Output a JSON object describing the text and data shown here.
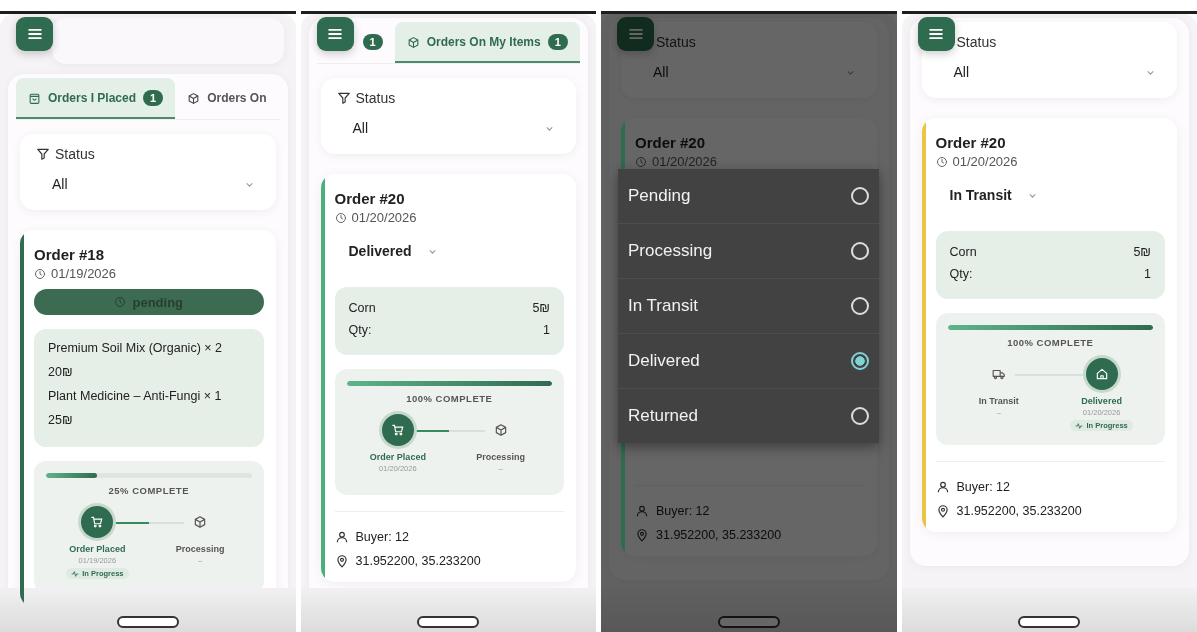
{
  "panels": [
    {
      "header": true,
      "dimmed": false,
      "tabs": [
        {
          "kind": "bag",
          "label": "Orders I Placed",
          "badge": "1",
          "selected": true
        },
        {
          "kind": "box",
          "label": "Orders On",
          "selected": false
        }
      ],
      "filter": {
        "label": "Status",
        "value": "All"
      },
      "order": {
        "title": "Order #18",
        "date": "01/19/2026",
        "color": "#2f6b4f",
        "status": {
          "kind": "pill",
          "label": "pending"
        },
        "items": {
          "kind": "stacked",
          "rows": [
            {
              "label": "Premium Soil Mix (Organic) × 2",
              "value": "20₪"
            },
            {
              "label": "Plant Medicine – Anti-Fungi × 1",
              "value": "25₪"
            }
          ]
        },
        "progress": {
          "level": 0.25,
          "label": "25% COMPLETE",
          "steps": [
            {
              "kind": "cart",
              "label": "Order Placed",
              "date": "01/19/2026",
              "active": true,
              "badge": "In Progress"
            },
            {
              "kind": "box",
              "label": "Processing",
              "date": "–",
              "active": false
            }
          ]
        }
      }
    },
    {
      "header": false,
      "dimmed": false,
      "tabs": [
        {
          "badge": "1",
          "selected": false
        },
        {
          "kind": "box",
          "label": "Orders On My Items",
          "badge": "1",
          "selected": true
        }
      ],
      "filter": {
        "label": "Status",
        "value": "All"
      },
      "order": {
        "title": "Order #20",
        "date": "01/20/2026",
        "color": "#4caf7d",
        "status": {
          "kind": "select",
          "label": "Delivered"
        },
        "items": {
          "kind": "split",
          "rows": [
            {
              "label": "Corn",
              "value": "5₪"
            },
            {
              "label": "Qty:",
              "value": "1"
            }
          ]
        },
        "progress": {
          "level": 1,
          "label": "100% COMPLETE",
          "steps": [
            {
              "kind": "cart",
              "label": "Order Placed",
              "date": "01/20/2026",
              "active": true
            },
            {
              "kind": "box",
              "label": "Processing",
              "date": "–",
              "active": false
            }
          ]
        },
        "buyer": "Buyer: 12",
        "location": "31.952200, 35.233200"
      }
    },
    {
      "header": false,
      "dimmed": true,
      "filter": {
        "label": "Status",
        "value": "All"
      },
      "order": {
        "title": "Order #20",
        "date": "01/20/2026",
        "color": "#2f6b4f",
        "covered": true,
        "buyer": "Buyer: 12",
        "location": "31.952200, 35.233200"
      },
      "menu": [
        {
          "label": "Pending",
          "selected": false
        },
        {
          "label": "Processing",
          "selected": false
        },
        {
          "label": "In Transit",
          "selected": false
        },
        {
          "label": "Delivered",
          "selected": true
        },
        {
          "label": "Returned",
          "selected": false
        }
      ]
    },
    {
      "header": false,
      "dimmed": false,
      "filter": {
        "label": "Status",
        "value": "All"
      },
      "order": {
        "title": "Order #20",
        "date": "01/20/2026",
        "color": "#e8c547",
        "status": {
          "kind": "select",
          "label": "In Transit"
        },
        "items": {
          "kind": "split",
          "rows": [
            {
              "label": "Corn",
              "value": "5₪"
            },
            {
              "label": "Qty:",
              "value": "1"
            }
          ]
        },
        "progress": {
          "level": 1,
          "label": "100% COMPLETE",
          "steps": [
            {
              "kind": "truck",
              "label": "In Transit",
              "date": "–",
              "active": false
            },
            {
              "kind": "home",
              "label": "Delivered",
              "date": "01/20/2026",
              "active": true,
              "badge": "In Progress"
            }
          ]
        },
        "buyer": "Buyer: 12",
        "location": "31.952200, 35.233200"
      }
    }
  ]
}
